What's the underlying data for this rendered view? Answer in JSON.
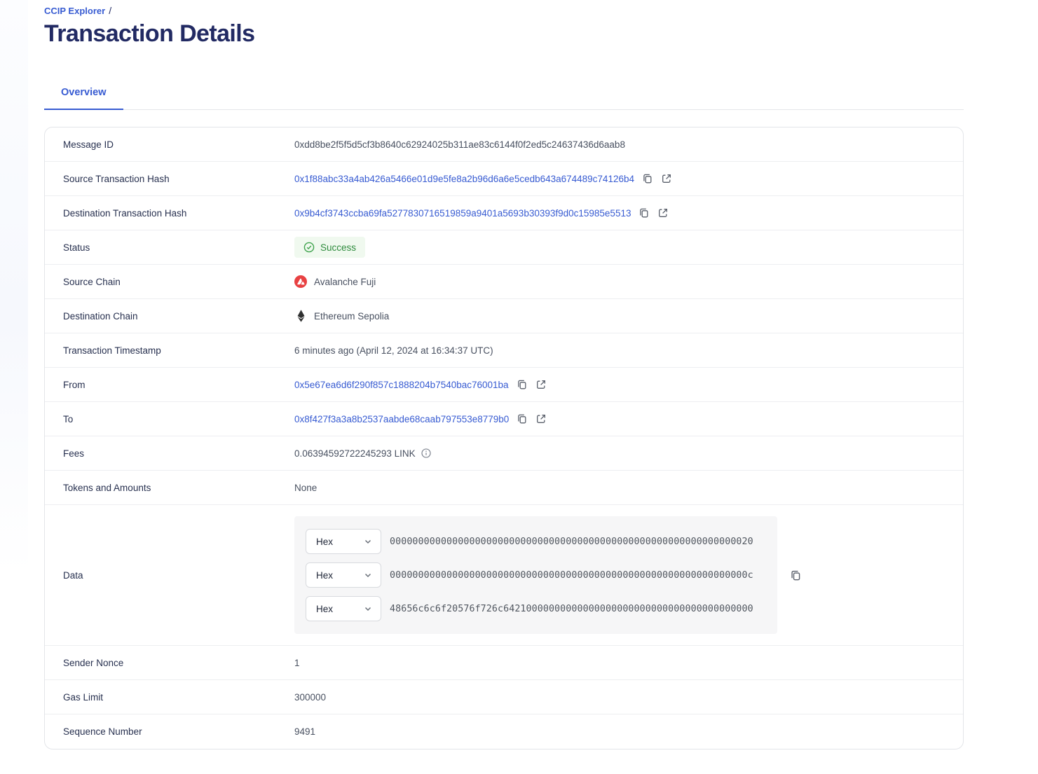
{
  "breadcrumb": {
    "label": "CCIP Explorer",
    "separator": "/"
  },
  "page": {
    "title": "Transaction Details"
  },
  "tabs": {
    "overview": "Overview"
  },
  "status_badge": {
    "label": "Success"
  },
  "details": {
    "message_id": {
      "label": "Message ID",
      "value": "0xdd8be2f5f5d5cf3b8640c62924025b311ae83c6144f0f2ed5c24637436d6aab8"
    },
    "source_tx_hash": {
      "label": "Source Transaction Hash",
      "value": "0x1f88abc33a4ab426a5466e01d9e5fe8a2b96d6a6e5cedb643a674489c74126b4"
    },
    "dest_tx_hash": {
      "label": "Destination Transaction Hash",
      "value": "0x9b4cf3743ccba69fa5277830716519859a9401a5693b30393f9d0c15985e5513"
    },
    "status": {
      "label": "Status"
    },
    "source_chain": {
      "label": "Source Chain",
      "value": "Avalanche Fuji"
    },
    "dest_chain": {
      "label": "Destination Chain",
      "value": "Ethereum Sepolia"
    },
    "timestamp": {
      "label": "Transaction Timestamp",
      "value": "6 minutes ago (April 12, 2024 at 16:34:37 UTC)"
    },
    "from": {
      "label": "From",
      "value": "0x5e67ea6d6f290f857c1888204b7540bac76001ba"
    },
    "to": {
      "label": "To",
      "value": "0x8f427f3a3a8b2537aabde68caab797553e8779b0"
    },
    "fees": {
      "label": "Fees",
      "value": "0.06394592722245293 LINK"
    },
    "tokens": {
      "label": "Tokens and Amounts",
      "value": "None"
    },
    "data": {
      "label": "Data"
    },
    "sender_nonce": {
      "label": "Sender Nonce",
      "value": "1"
    },
    "gas_limit": {
      "label": "Gas Limit",
      "value": "300000"
    },
    "sequence_number": {
      "label": "Sequence Number",
      "value": "9491"
    }
  },
  "data_section": {
    "lines": [
      {
        "format": "Hex",
        "value": "0000000000000000000000000000000000000000000000000000000000000020"
      },
      {
        "format": "Hex",
        "value": "000000000000000000000000000000000000000000000000000000000000000c"
      },
      {
        "format": "Hex",
        "value": "48656c6c6f20576f726c64210000000000000000000000000000000000000000"
      }
    ]
  },
  "colors": {
    "accent_blue": "#375bd2",
    "heading_navy": "#222a63",
    "success_text": "#2e8b3d",
    "success_bg": "#f0f9ef",
    "avalanche_red": "#e84142",
    "ethereum_dark": "#2f3030"
  }
}
